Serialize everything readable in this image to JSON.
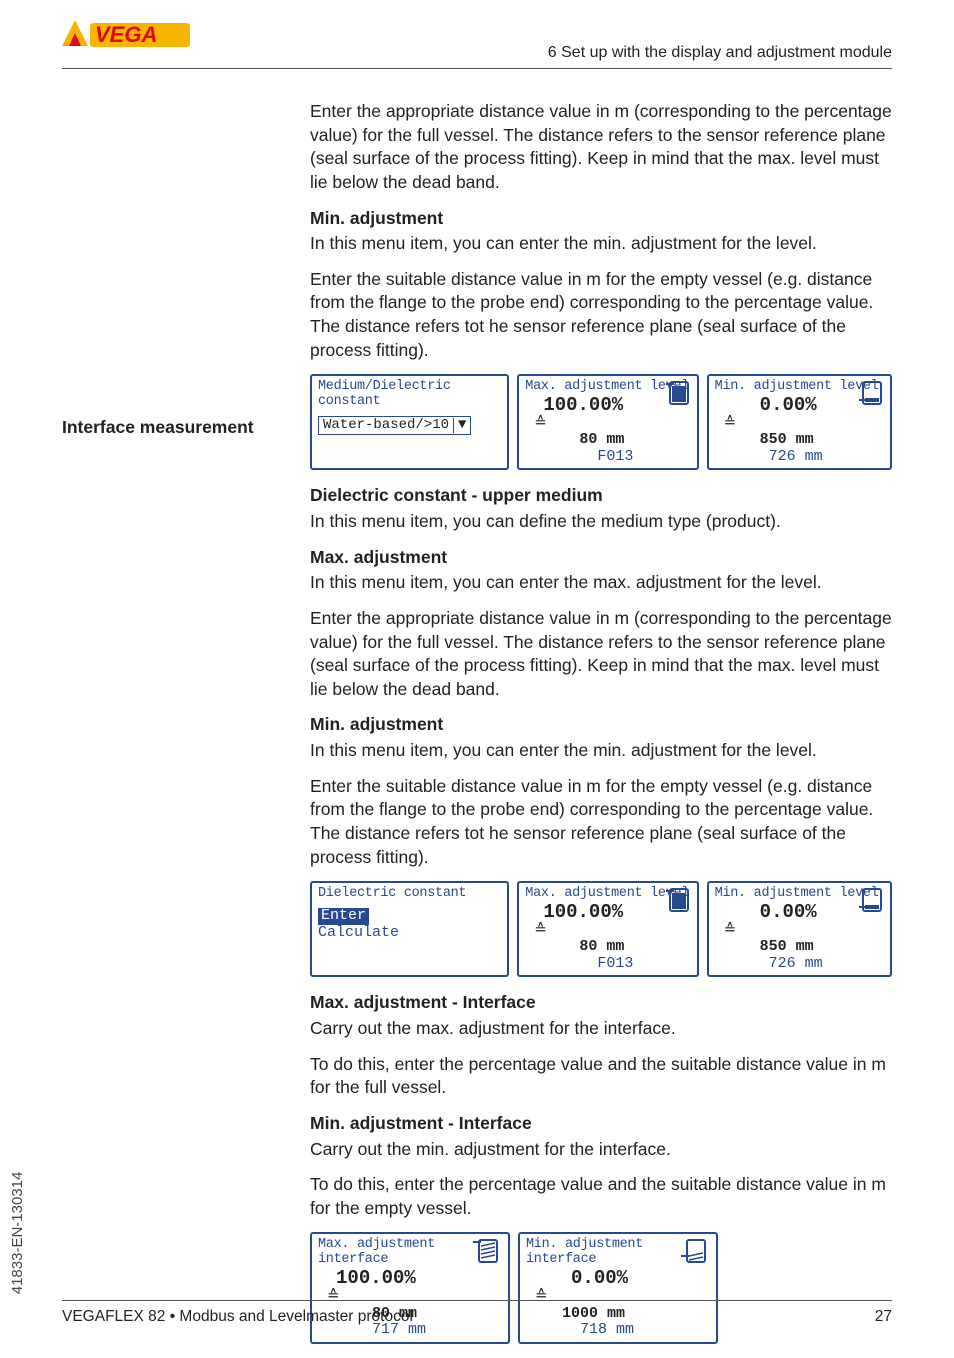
{
  "header": {
    "section_title": "6 Set up with the display and adjustment module"
  },
  "logo": {
    "letters": "VEGA"
  },
  "intro_para": "Enter the appropriate distance value in m (corresponding to the percentage value) for the full vessel. The distance refers to the sensor reference plane (seal surface of the process fitting). Keep in mind that the max. level must lie below the dead band.",
  "section_a": {
    "min_heading": "Min. adjustment",
    "min_p1": "In this menu item, you can enter the min. adjustment for the level.",
    "min_p2": "Enter the suitable distance value in m for the empty vessel (e.g. distance from the flange to the probe end) corresponding to the percentage value. The distance refers tot he sensor reference plane (seal surface of the process fitting)."
  },
  "lcd_a": {
    "l1_title": "Medium/Dielectric constant",
    "l1_combo": "Water-based/>10",
    "l2_title": "Max. adjustment level",
    "l2_big": "100.00%",
    "l2_mm": "80 mm",
    "l2_code": "F013",
    "l3_title": "Min. adjustment level",
    "l3_big": "0.00%",
    "l3_mm": "850 mm",
    "l3_alt": "726 mm"
  },
  "left_label": "Interface measurement",
  "section_b": {
    "dk_heading": "Dielectric constant - upper medium",
    "dk_p": "In this menu item, you can define the medium type (product).",
    "max_heading": "Max. adjustment",
    "max_p1": "In this menu item, you can enter the max. adjustment for the level.",
    "max_p2": "Enter the appropriate distance value in m (corresponding to the percentage value) for the full vessel. The distance refers to the sensor reference plane (seal surface of the process fitting). Keep in mind that the max. level must lie below the dead band.",
    "min_heading": "Min. adjustment",
    "min_p1": "In this menu item, you can enter the min. adjustment for the level.",
    "min_p2": "Enter the suitable distance value in m for the empty vessel (e.g. distance from the flange to the probe end) corresponding to the percentage value. The distance refers tot he sensor reference plane (seal surface of the process fitting)."
  },
  "lcd_b": {
    "l1_title": "Dielectric constant",
    "l1_opt1": "Enter",
    "l1_opt2": "Calculate",
    "l2_title": "Max. adjustment level",
    "l2_big": "100.00%",
    "l2_mm": "80 mm",
    "l2_code": "F013",
    "l3_title": "Min. adjustment level",
    "l3_big": "0.00%",
    "l3_mm": "850 mm",
    "l3_alt": "726 mm"
  },
  "section_c": {
    "maxif_heading": "Max. adjustment - Interface",
    "maxif_p1": "Carry out the max. adjustment for the interface.",
    "maxif_p2": "To do this, enter the percentage value and the suitable distance value in m for the full vessel.",
    "minif_heading": "Min. adjustment - Interface",
    "minif_p1": "Carry out the min. adjustment for the interface.",
    "minif_p2": "To do this, enter the percentage value and the suitable distance value in m for the empty vessel."
  },
  "lcd_c": {
    "l1_title": "Max. adjustment interface",
    "l1_big": "100.00%",
    "l1_mm": "80 mm",
    "l1_alt": "717 mm",
    "l2_title": "Min. adjustment interface",
    "l2_big": "0.00%",
    "l2_mm": "1000 mm",
    "l2_alt": "718 mm"
  },
  "side_vertical": "41833-EN-130314",
  "footer": {
    "left": "VEGAFLEX 82 • Modbus and Levelmaster protocol",
    "right": "27"
  }
}
